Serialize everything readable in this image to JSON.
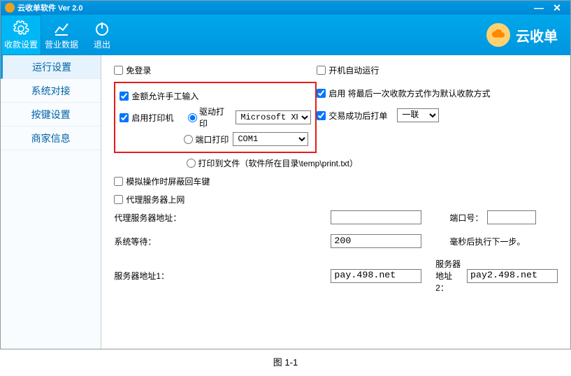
{
  "window": {
    "title": "云收单软件 Ver 2.0"
  },
  "winbtns": {
    "min": "—",
    "close": "✕"
  },
  "toolbar": {
    "items": [
      {
        "label": "收款设置"
      },
      {
        "label": "营业数据"
      },
      {
        "label": "退出"
      }
    ],
    "brand": "云收单"
  },
  "sidebar": {
    "items": [
      {
        "label": "运行设置"
      },
      {
        "label": "系统对接"
      },
      {
        "label": "按键设置"
      },
      {
        "label": "商家信息"
      }
    ]
  },
  "settings": {
    "free_login_label": "免登录",
    "auto_start_label": "开机自动运行",
    "manual_amount_label": "金额允许手工输入",
    "use_last_method_label": "启用 将最后一次收款方式作为默认收款方式",
    "enable_printer_label": "启用打印机",
    "driver_print_label": "驱动打印",
    "driver_print_value": "Microsoft XPS D",
    "port_print_label": "端口打印",
    "port_print_value": "COM1",
    "success_print_label": "交易成功后打单",
    "success_print_value": "一联",
    "print_to_file_label": "打印到文件（软件所在目录\\temp\\print.txt）",
    "mask_enter_label": "模拟操作时屏蔽回车键",
    "proxy_online_label": "代理服务器上网",
    "proxy_addr_label": "代理服务器地址：",
    "proxy_addr_value": "",
    "port_label": "端口号：",
    "port_value": "",
    "sys_wait_label": "系统等待：",
    "sys_wait_value": "200",
    "sys_wait_suffix": "毫秒后执行下一步。",
    "server1_label": "服务器地址1：",
    "server1_value": "pay.498.net",
    "server2_label": "服务器地址2：",
    "server2_value": "pay2.498.net"
  },
  "caption": "图 1-1"
}
